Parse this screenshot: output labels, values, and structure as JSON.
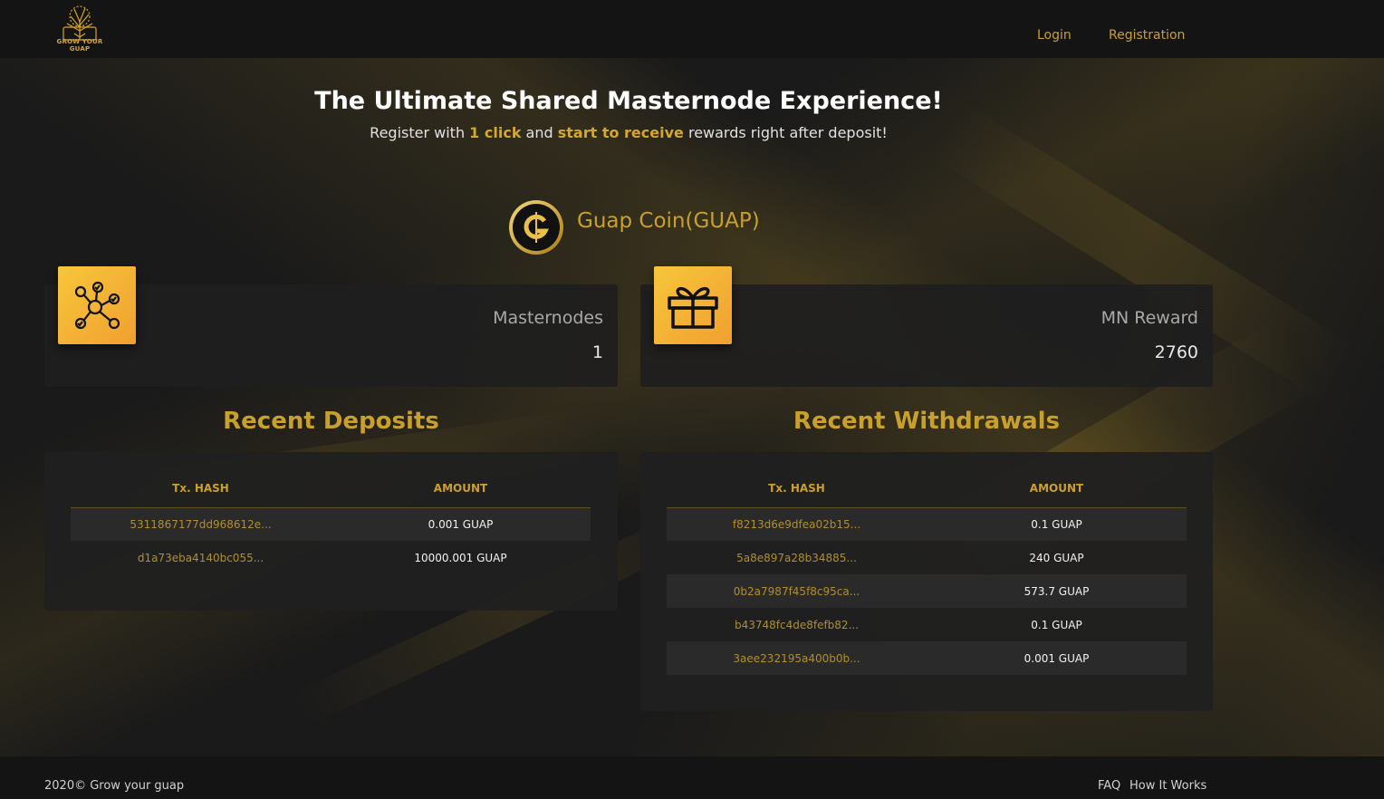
{
  "header": {
    "logo_text": "GROW YOUR GUAP",
    "nav": {
      "login": "Login",
      "registration": "Registration"
    }
  },
  "hero": {
    "title": "The Ultimate Shared Masternode Experience!",
    "sub_1": "Register with ",
    "sub_hl1": "1 click",
    "sub_2": " and ",
    "sub_hl2": "start to receive",
    "sub_3": " rewards right after deposit!"
  },
  "coin": {
    "name": "Guap Coin(GUAP)",
    "icon": "guap-coin-logo"
  },
  "stats": {
    "masternodes": {
      "label": "Masternodes",
      "value": "1",
      "icon": "network-nodes-icon"
    },
    "mn_reward": {
      "label": "MN Reward",
      "value": "2760",
      "icon": "gift-icon"
    }
  },
  "deposits": {
    "title": "Recent Deposits",
    "columns": [
      "Tx. HASH",
      "AMOUNT"
    ],
    "rows": [
      {
        "hash": "5311867177dd968612e...",
        "amount": "0.001 GUAP"
      },
      {
        "hash": "d1a73eba4140bc055...",
        "amount": "10000.001 GUAP"
      }
    ]
  },
  "withdrawals": {
    "title": "Recent Withdrawals",
    "columns": [
      "Tx. HASH",
      "AMOUNT"
    ],
    "rows": [
      {
        "hash": "f8213d6e9dfea02b15...",
        "amount": "0.1 GUAP"
      },
      {
        "hash": "5a8e897a28b34885...",
        "amount": "240 GUAP"
      },
      {
        "hash": "0b2a7987f45f8c95ca...",
        "amount": "573.7 GUAP"
      },
      {
        "hash": "b43748fc4de8fefb82...",
        "amount": "0.1 GUAP"
      },
      {
        "hash": "3aee232195a400b0b...",
        "amount": "0.001 GUAP"
      }
    ]
  },
  "footer": {
    "copyright": "2020©   Grow your guap",
    "faq": "FAQ",
    "how": "How It Works"
  },
  "colors": {
    "accent": "#c9a02c",
    "background": "#1b1b1b",
    "icon_gradient_start": "#f7c63b",
    "icon_gradient_end": "#f0a030"
  }
}
